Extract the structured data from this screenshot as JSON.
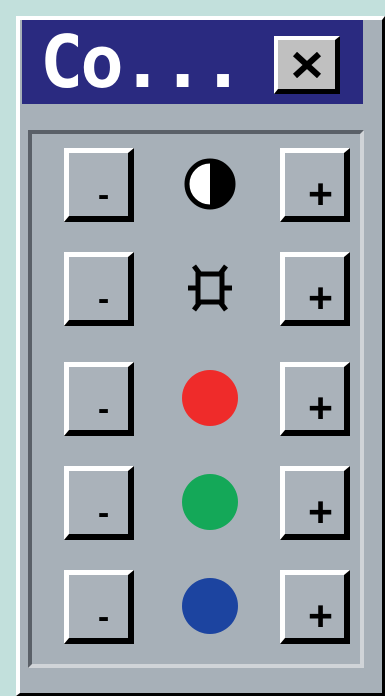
{
  "window": {
    "title": "Co...",
    "close_label": "x"
  },
  "rows": [
    {
      "id": "contrast",
      "icon": "contrast-icon",
      "minus": "-",
      "plus": "+"
    },
    {
      "id": "brightness",
      "icon": "brightness-icon",
      "minus": "-",
      "plus": "+"
    },
    {
      "id": "red",
      "icon": "red-dot-icon",
      "color": "#ef2b2a",
      "minus": "-",
      "plus": "+"
    },
    {
      "id": "green",
      "icon": "green-dot-icon",
      "color": "#14a858",
      "minus": "-",
      "plus": "+"
    },
    {
      "id": "blue",
      "icon": "blue-dot-icon",
      "color": "#1c44a0",
      "minus": "-",
      "plus": "+"
    }
  ],
  "colors": {
    "desktop": "#c2e0dc",
    "titlebar": "#2a2a80",
    "window": "#a7b0b8"
  }
}
